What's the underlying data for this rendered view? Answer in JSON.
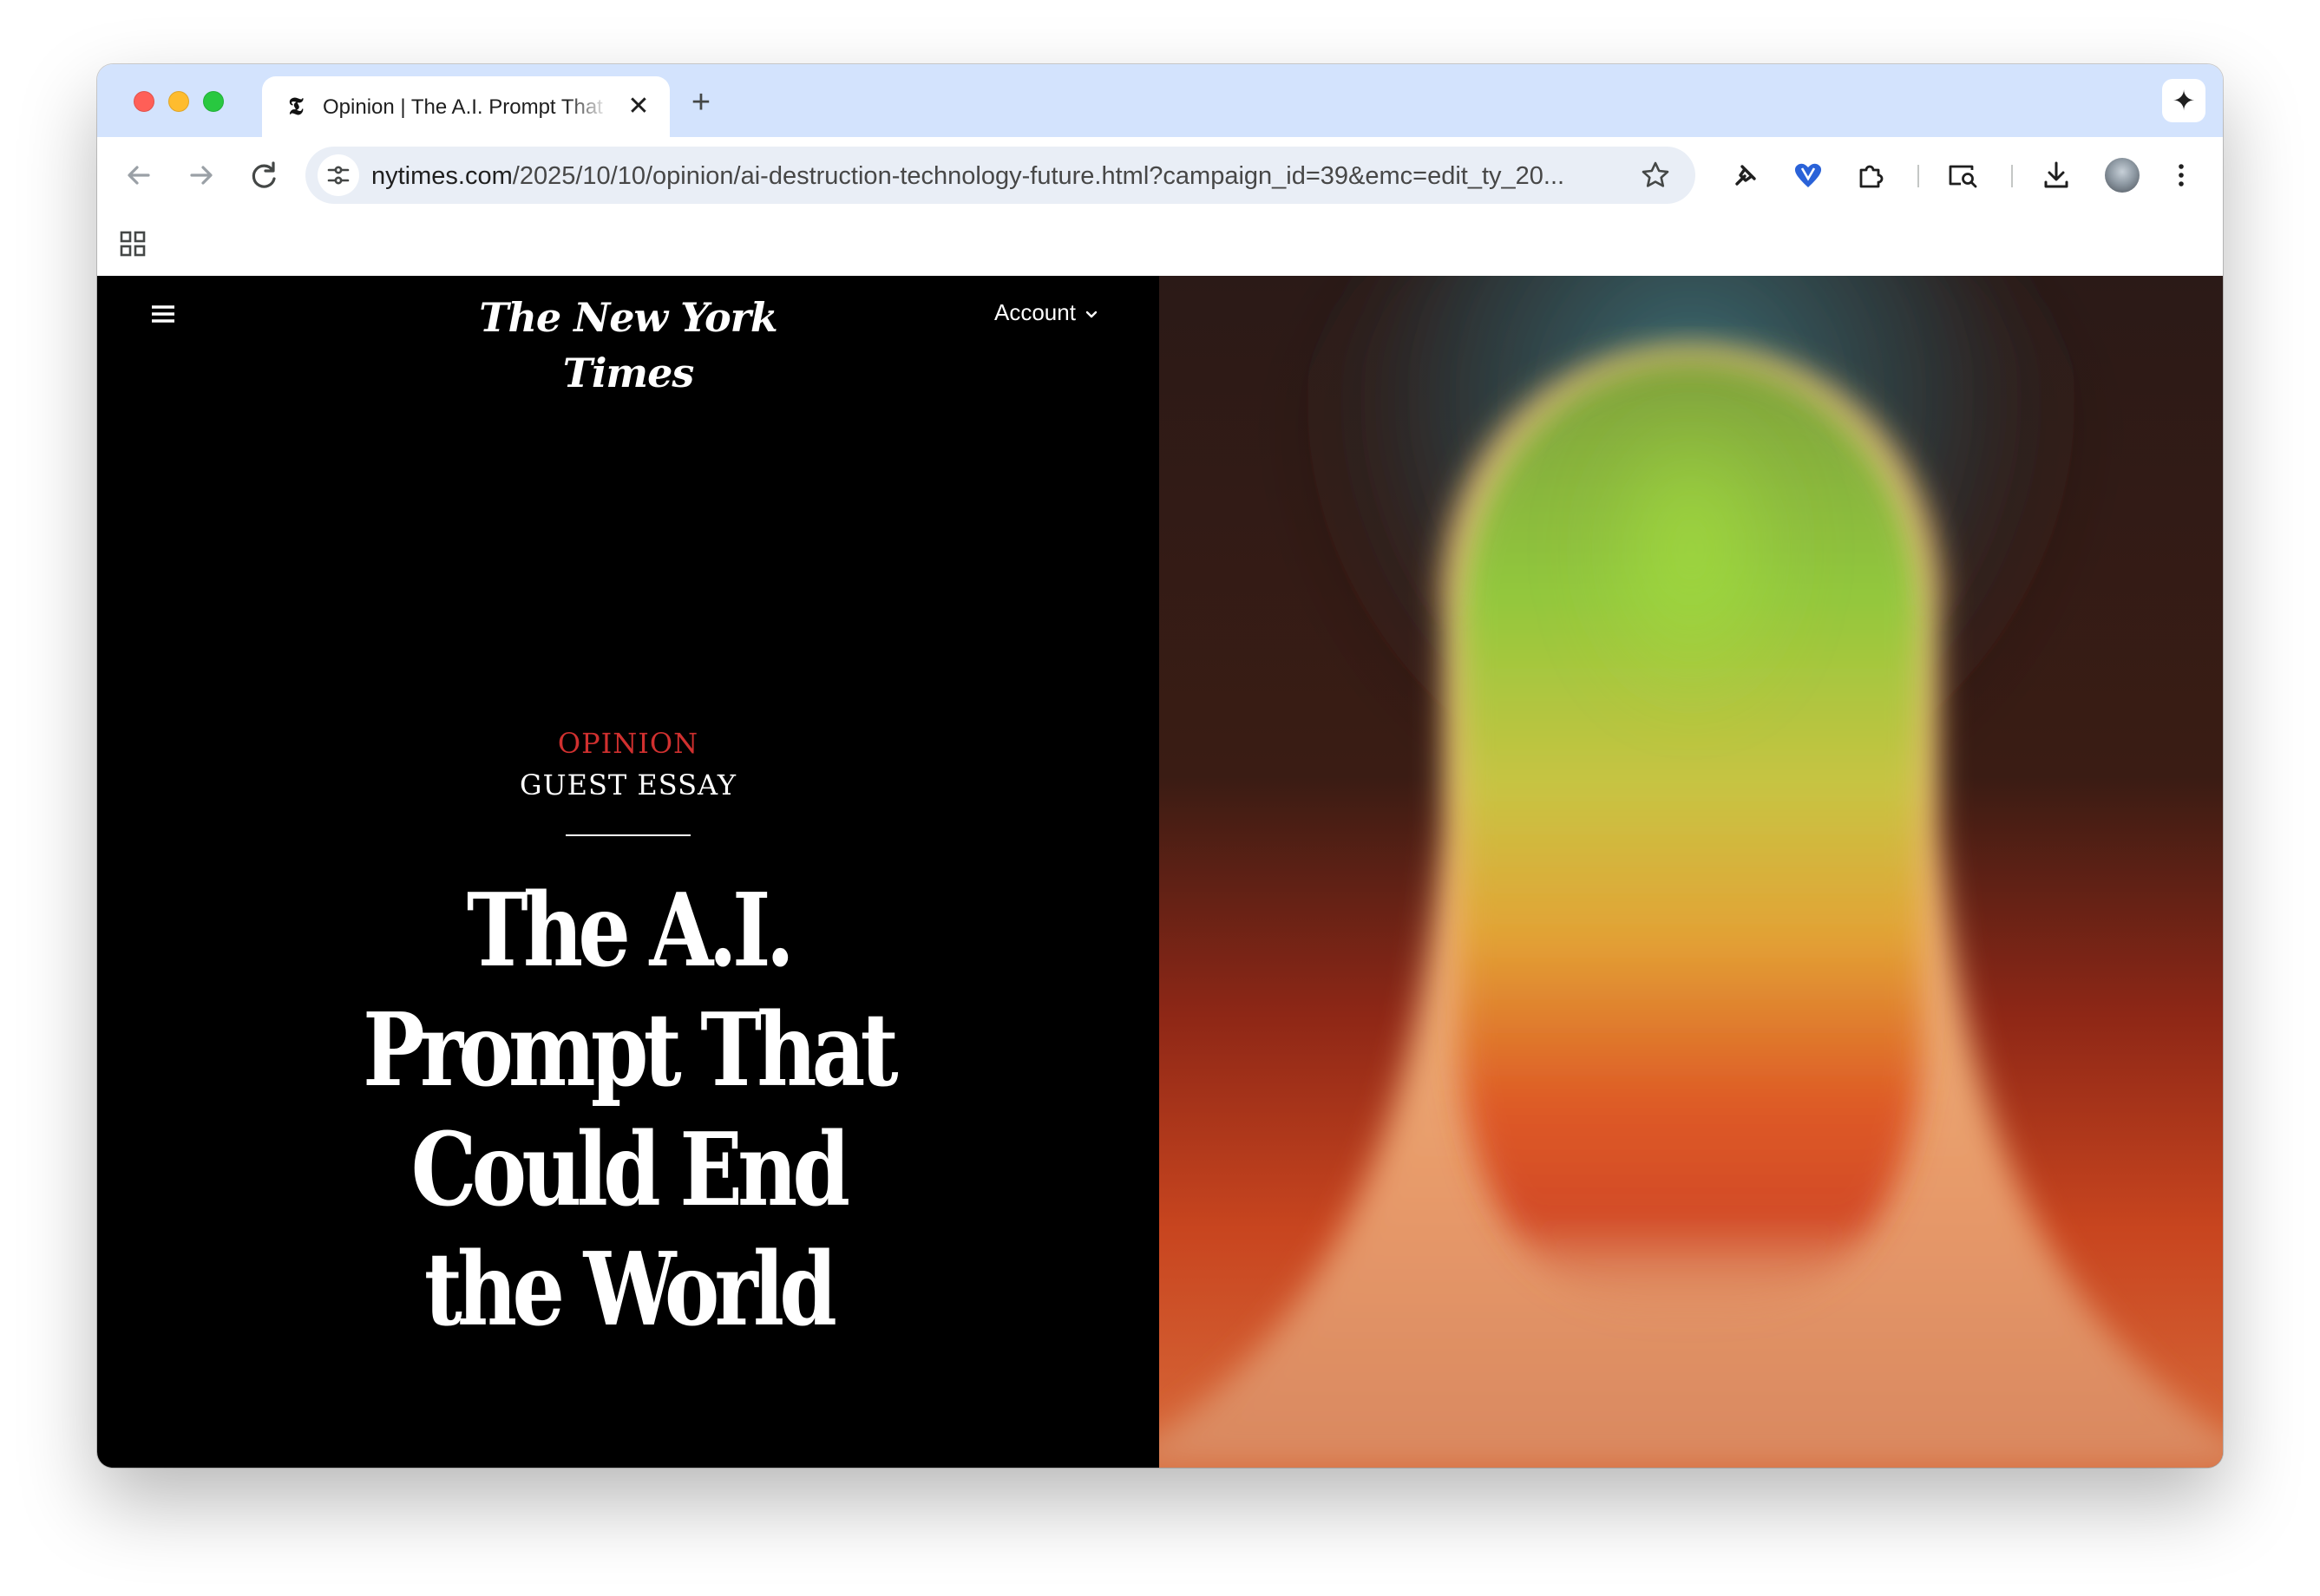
{
  "browser": {
    "tab": {
      "favicon": "𝕿",
      "title": "Opinion | The A.I. Prompt That Could End the World",
      "close_symbol": "✕"
    },
    "new_tab_symbol": "+",
    "gemini_symbol": "✦",
    "url_host": "nytimes.com",
    "url_path": "/2025/10/10/opinion/ai-destruction-technology-future.html?campaign_id=39&emc=edit_ty_20...",
    "icons": {
      "back": "back-arrow-icon",
      "forward": "forward-arrow-icon",
      "reload": "reload-icon",
      "site_info": "tune-icon",
      "bookmark": "star-icon",
      "extension_1": "pin-extension-icon",
      "extension_2": "heart-shield-extension-icon",
      "extensions": "puzzle-icon",
      "search_tab": "search-tab-icon",
      "downloads": "download-icon",
      "menu": "kebab-menu-icon",
      "apps": "apps-grid-icon"
    }
  },
  "page": {
    "masthead": "The New York Times",
    "account_label": "Account",
    "kicker": "OPINION",
    "subkicker": "GUEST ESSAY",
    "headline": "The A.I. Prompt That Could End the World",
    "colors": {
      "kicker": "#d0302f",
      "background": "#000000",
      "text": "#ffffff"
    }
  }
}
